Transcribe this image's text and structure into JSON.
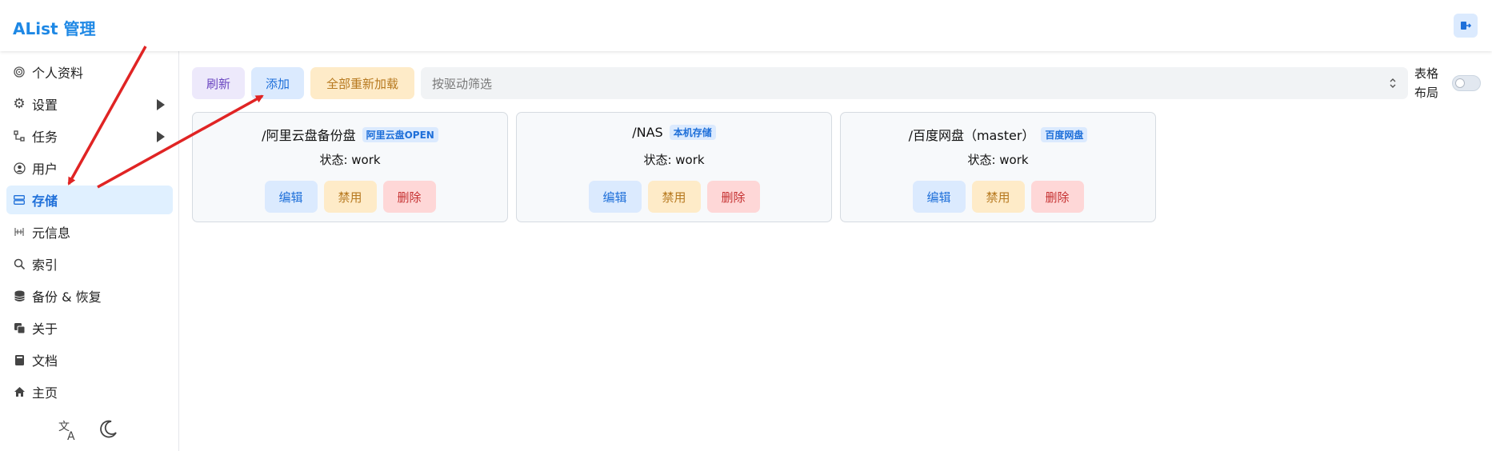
{
  "header": {
    "title": "AList 管理"
  },
  "sidebar": {
    "items": [
      {
        "label": "个人资料",
        "icon": "fingerprint-icon"
      },
      {
        "label": "设置",
        "icon": "gear-icon"
      },
      {
        "label": "任务",
        "icon": "task-icon"
      },
      {
        "label": "用户",
        "icon": "user-circle-icon"
      },
      {
        "label": "存储",
        "icon": "storage-icon"
      },
      {
        "label": "元信息",
        "icon": "meta-icon"
      },
      {
        "label": "索引",
        "icon": "search-icon"
      },
      {
        "label": "备份 & 恢复",
        "icon": "database-icon"
      },
      {
        "label": "关于",
        "icon": "copy-icon"
      },
      {
        "label": "文档",
        "icon": "book-icon"
      },
      {
        "label": "主页",
        "icon": "home-icon"
      }
    ],
    "active": "存储"
  },
  "toolbar": {
    "refresh": "刷新",
    "add": "添加",
    "reload_all": "全部重新加载",
    "filter_placeholder": "按驱动筛选",
    "table_layout": "表格布局"
  },
  "storages": [
    {
      "path": "/阿里云盘备份盘",
      "driver": "阿里云盘OPEN",
      "status": "状态: work",
      "edit": "编辑",
      "disable": "禁用",
      "delete": "删除"
    },
    {
      "path": "/NAS",
      "driver": "本机存储",
      "status": "状态: work",
      "edit": "编辑",
      "disable": "禁用",
      "delete": "删除"
    },
    {
      "path": "/百度网盘（master）",
      "driver": "百度网盘",
      "status": "状态: work",
      "edit": "编辑",
      "disable": "禁用",
      "delete": "删除"
    }
  ],
  "colors": {
    "accent": "#1e88e5",
    "annotation_arrow": "#e02424"
  }
}
